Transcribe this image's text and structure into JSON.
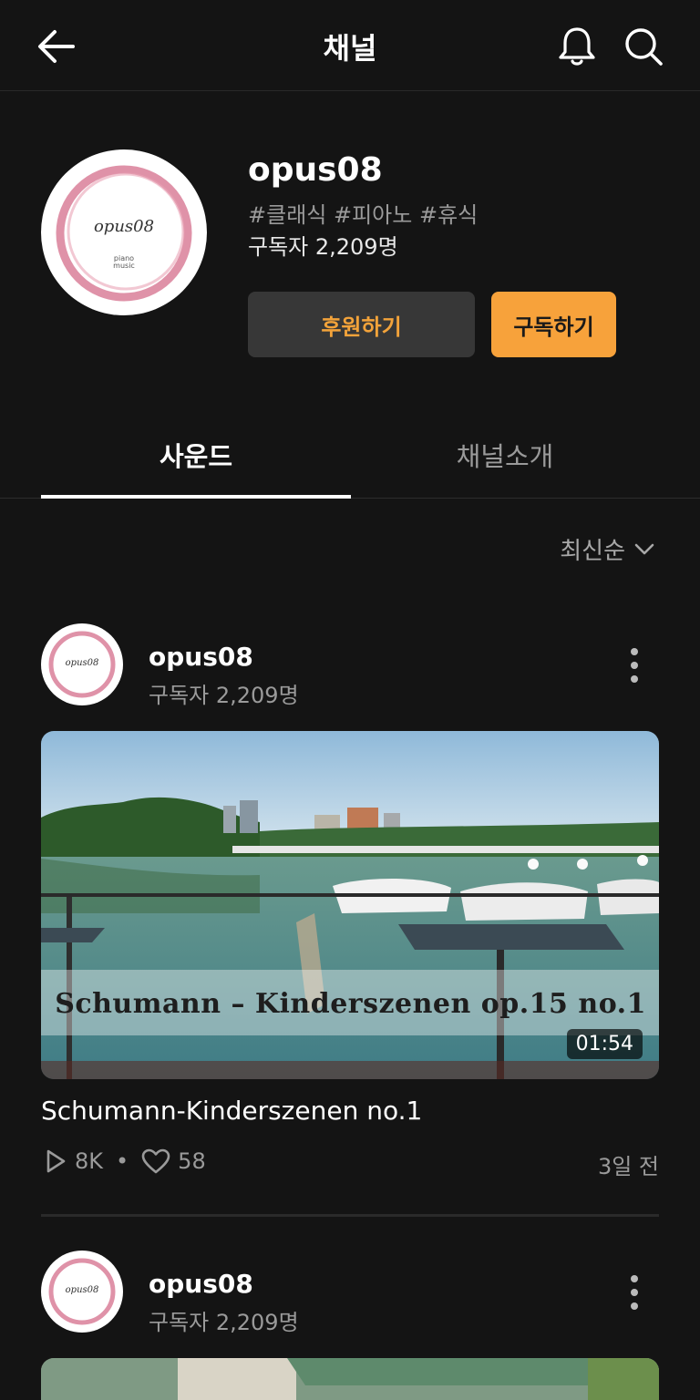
{
  "header": {
    "title": "채널"
  },
  "channel": {
    "name": "opus08",
    "tags": "#클래식 #피아노 #휴식",
    "subscribers": "구독자 2,209명",
    "logo_text": "opus08",
    "logo_sub1": "piano",
    "logo_sub2": "music",
    "support_label": "후원하기",
    "subscribe_label": "구독하기"
  },
  "tabs": [
    {
      "label": "사운드"
    },
    {
      "label": "채널소개"
    }
  ],
  "sort": {
    "label": "최신순"
  },
  "posts": [
    {
      "author": "opus08",
      "subscribers": "구독자 2,209명",
      "overlay_title": "Schumann – Kinderszenen op.15 no.1",
      "duration": "01:54",
      "title": "Schumann-Kinderszenen no.1",
      "plays": "8K",
      "likes": "58",
      "date": "3일 전"
    },
    {
      "author": "opus08",
      "subscribers": "구독자 2,209명"
    }
  ],
  "colors": {
    "accent": "#f7a23b",
    "background": "#141414"
  }
}
